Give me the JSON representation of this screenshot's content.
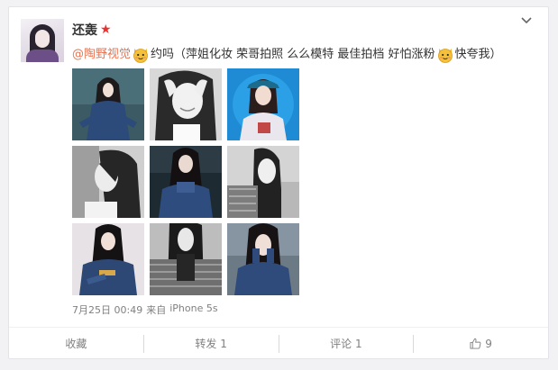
{
  "post": {
    "username": "还轰",
    "star_icon": "★",
    "mention": "@陶野视觉",
    "emoji_icon": "cat-face-emoji",
    "text_part1": "约吗（萍姐化妆 荣哥拍照 么么模特 最佳拍档 好怕涨粉",
    "text_part2": "快夸我）",
    "timestamp": "7月25日 00:49",
    "source_prefix": "来自",
    "source": "iPhone 5s",
    "photo_count": 9
  },
  "actions": {
    "favorite": "收藏",
    "repost": "转发 1",
    "comment": "评论 1",
    "like": "9"
  },
  "colors": {
    "mention": "#eb7350",
    "star": "#e8322e",
    "text": "#333333",
    "meta": "#808080"
  }
}
